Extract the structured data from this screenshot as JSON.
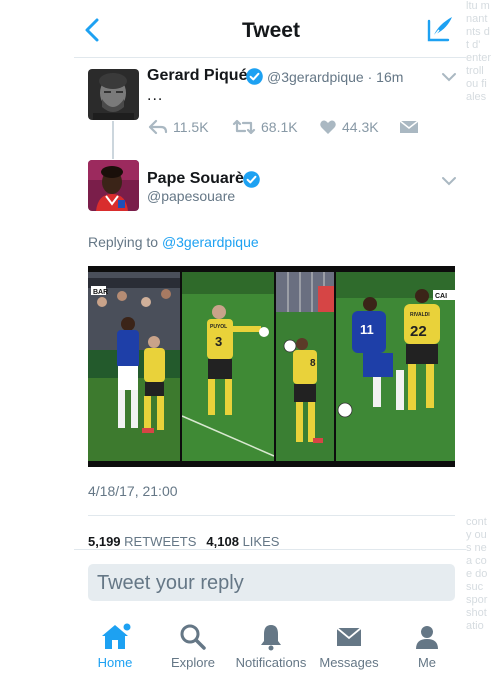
{
  "header": {
    "title": "Tweet",
    "back_icon": "chevron-left-icon",
    "compose_icon": "compose-icon",
    "accent_color": "#1da1f2"
  },
  "parent_tweet": {
    "name": "Gerard Piqué",
    "handle": "@3gerardpique",
    "time": "16m",
    "handle_time": "@3gerardpique · 16m",
    "body": "...",
    "replies": "11.5K",
    "retweets": "68.1K",
    "likes": "44.3K"
  },
  "main_tweet": {
    "name": "Pape Souarè",
    "handle": "@papesouare",
    "replying_prefix": "Replying to ",
    "replying_to": "@3gerardpique",
    "timestamp": "4/18/17, 21:00",
    "retweet_count": "5,199",
    "retweets_label": "RETWEETS",
    "like_count": "4,108",
    "likes_label": "LIKES",
    "media_overlay": {
      "left_badge": "BAR",
      "right_badge": "CAI",
      "jersey_numbers": [
        "3",
        "8",
        "11",
        "22"
      ],
      "jersey_text": [
        "PUYOL",
        "RIVALDI"
      ]
    }
  },
  "reply": {
    "placeholder": "Tweet your reply"
  },
  "tabbar": {
    "items": [
      {
        "label": "Home",
        "icon": "home-icon",
        "active": true
      },
      {
        "label": "Explore",
        "icon": "search-icon",
        "active": false
      },
      {
        "label": "Notifications",
        "icon": "bell-icon",
        "active": false
      },
      {
        "label": "Messages",
        "icon": "envelope-icon",
        "active": false
      },
      {
        "label": "Me",
        "icon": "person-icon",
        "active": false
      }
    ]
  },
  "background_text": [
    "ltu m",
    "nant",
    "nts d",
    "t d'",
    "enter",
    "troll",
    "ou fi",
    "ales",
    "",
    "",
    "",
    "",
    "",
    "",
    "",
    "",
    "",
    "",
    "",
    "",
    "",
    "",
    "",
    "",
    "",
    "",
    "",
    "",
    "",
    "",
    "",
    "",
    "",
    "",
    "",
    "",
    "",
    "",
    "cont",
    "y ou",
    "s ne",
    "a co",
    "e do",
    "suc",
    "spor",
    "shot",
    "atio"
  ]
}
